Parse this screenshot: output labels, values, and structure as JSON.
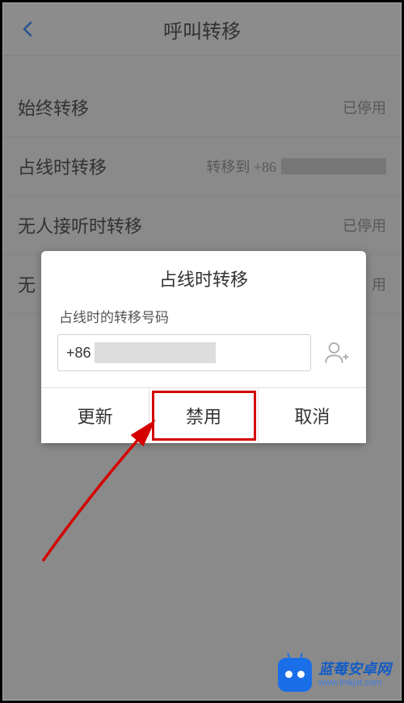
{
  "header": {
    "title": "呼叫转移"
  },
  "settings": {
    "items": [
      {
        "label": "始终转移",
        "value": "已停用"
      },
      {
        "label": "占线时转移",
        "value_prefix": "转移到 +86"
      },
      {
        "label": "无人接听时转移",
        "value": "已停用"
      },
      {
        "label_prefix": "无",
        "value_suffix": "用"
      }
    ]
  },
  "dialog": {
    "title": "占线时转移",
    "field_label": "占线时的转移号码",
    "phone_prefix": "+86",
    "buttons": {
      "update": "更新",
      "disable": "禁用",
      "cancel": "取消"
    }
  },
  "watermark": {
    "name": "蓝莓安卓网",
    "url": "www.lmkjst.com"
  }
}
